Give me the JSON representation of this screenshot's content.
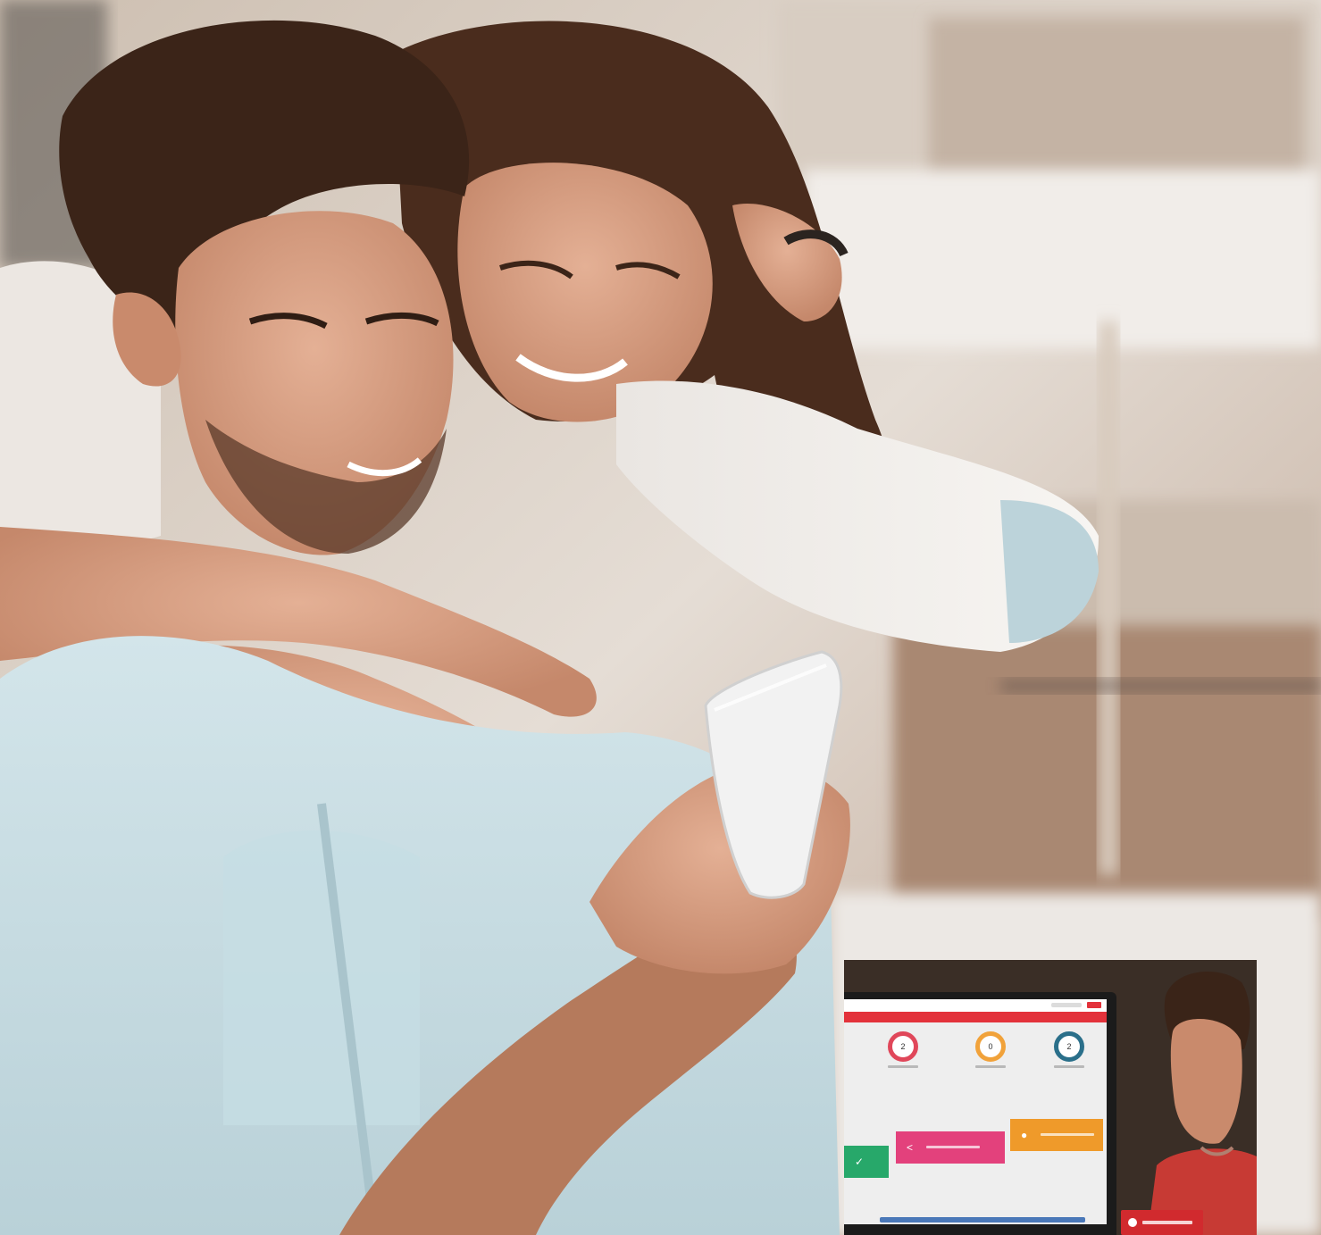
{
  "scene": {
    "subject": "couple-with-smartphone",
    "palette": {
      "background": "#d9d2ca",
      "shirt": "#c7dde3",
      "hair": "#3b2418",
      "skin": "#d9a184",
      "phone": "#f2f2f2"
    }
  },
  "inset": {
    "app": {
      "accent_color": "#e3323b",
      "stats": [
        {
          "value": "2",
          "color": "#e0475a"
        },
        {
          "value": "0",
          "color": "#f1a23a"
        },
        {
          "value": "2",
          "color": "#2a6f8a"
        }
      ],
      "tiles": [
        {
          "color": "#27a86a",
          "icon": "check-icon"
        },
        {
          "color": "#e3417c",
          "icon": "share-icon"
        },
        {
          "color": "#ef9a2a",
          "icon": "user-icon"
        }
      ]
    }
  }
}
